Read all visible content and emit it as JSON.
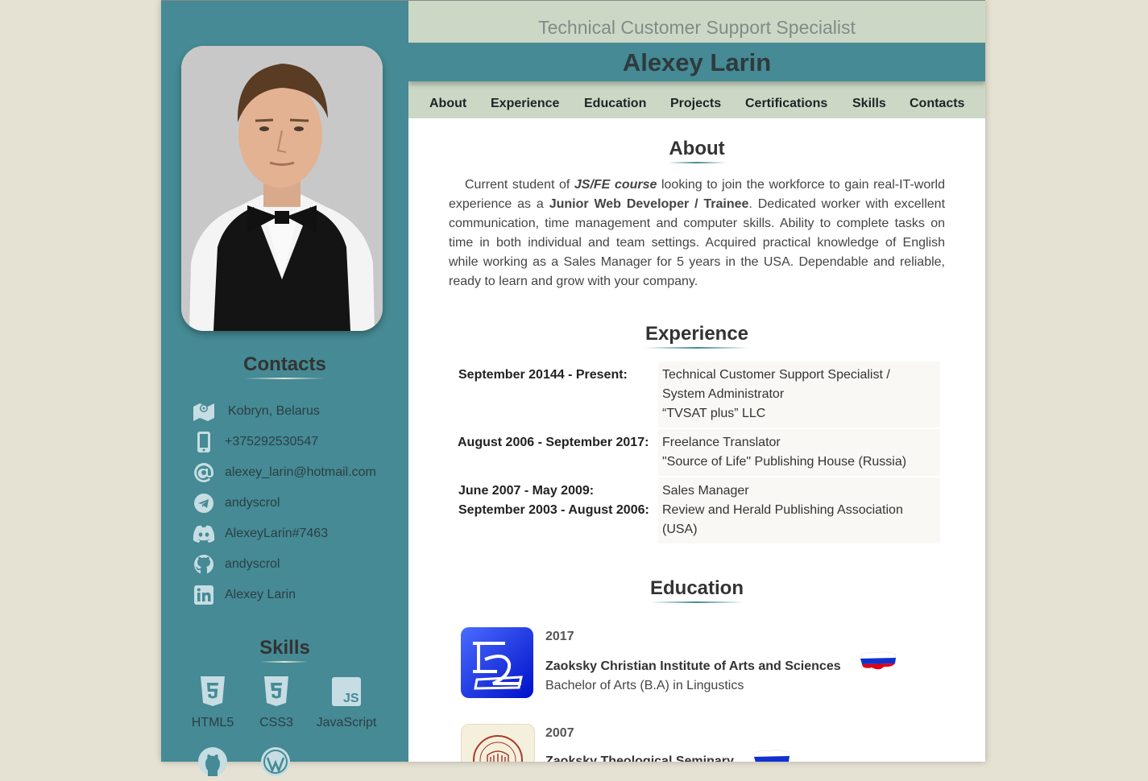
{
  "sidebar": {
    "contacts_heading": "Contacts",
    "contacts": [
      {
        "icon": "map-icon",
        "text": "Kobryn, Belarus"
      },
      {
        "icon": "phone-icon",
        "text": "+375292530547"
      },
      {
        "icon": "at-icon",
        "text": "alexey_larin@hotmail.com"
      },
      {
        "icon": "telegram-icon",
        "text": "andyscrol"
      },
      {
        "icon": "discord-icon",
        "text": "AlexeyLarin#7463"
      },
      {
        "icon": "github-icon",
        "text": "andyscrol"
      },
      {
        "icon": "linkedin-icon",
        "text": "Alexey Larin"
      }
    ],
    "skills_heading": "Skills",
    "skills": [
      {
        "icon": "html5-icon",
        "label": "HTML5"
      },
      {
        "icon": "css3-icon",
        "label": "CSS3"
      },
      {
        "icon": "javascript-icon",
        "label": "JavaScript"
      }
    ]
  },
  "header": {
    "subtitle": "Technical Customer Support Specialist",
    "name": "Alexey Larin"
  },
  "nav": [
    "About",
    "Experience",
    "Education",
    "Projects",
    "Certifications",
    "Skills",
    "Contacts"
  ],
  "about": {
    "title": "About",
    "p1": "Current student of ",
    "p1_em": "JS/FE course",
    "p2": " looking to join the workforce to gain real-IT-world experience as a ",
    "p2_strong": "Junior Web Developer / Trainee",
    "p3": ". Dedicated worker with excellent communication, time management and computer skills. Ability to complete tasks on time in both individual and team settings. Acquired practical knowledge of English while working as a Sales Manager for 5 years in the USA. Dependable and reliable, ready to learn and grow with your company."
  },
  "experience": {
    "title": "Experience",
    "items": [
      {
        "dates": [
          "September 20144 - Present:"
        ],
        "lines": [
          "Technical Customer Support Specialist /",
          "System Administrator",
          "“TVSAT plus” LLC"
        ]
      },
      {
        "dates": [
          "August 2006 - September 2017:"
        ],
        "lines": [
          "Freelance Translator",
          "\"Source of Life\" Publishing House (Russia)"
        ]
      },
      {
        "dates": [
          "June 2007 - May 2009:",
          "September 2003 - August 2006:"
        ],
        "lines": [
          "Sales Manager",
          "Review and Herald Publishing Association",
          "(USA)"
        ]
      }
    ]
  },
  "education": {
    "title": "Education",
    "items": [
      {
        "year": "2017",
        "school": "Zaoksky Christian Institute of Arts and Sciences",
        "degree": "Bachelor of Arts (B.A) in Lingustics"
      },
      {
        "year": "2007",
        "school": "Zaoksky Theological Seminary",
        "degree": ""
      }
    ]
  },
  "colors": {
    "sidebar": "#458a94",
    "banner": "#ccd8c5",
    "background": "#e6e2d3"
  }
}
